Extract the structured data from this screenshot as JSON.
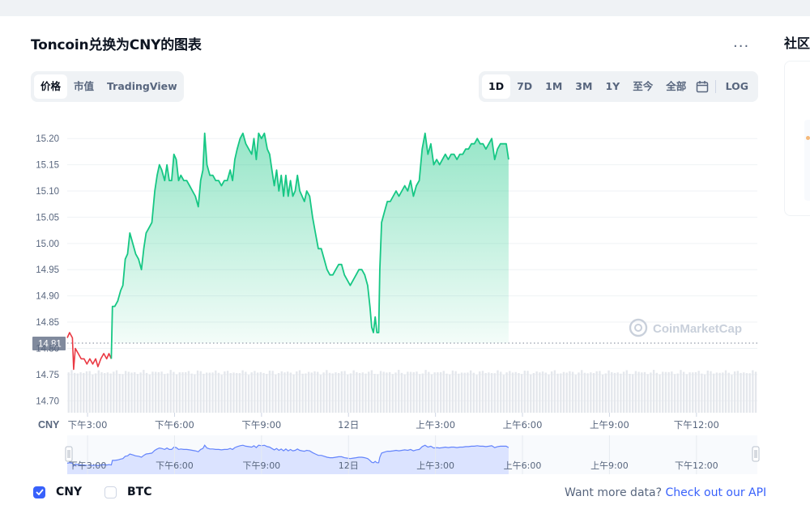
{
  "header": {
    "title": "Toncoin兑换为CNY的图表",
    "more_label": "..."
  },
  "tabs": [
    {
      "label": "价格",
      "active": true
    },
    {
      "label": "市值",
      "active": false
    },
    {
      "label": "TradingView",
      "active": false
    }
  ],
  "ranges": [
    {
      "label": "1D",
      "active": true
    },
    {
      "label": "7D",
      "active": false
    },
    {
      "label": "1M",
      "active": false
    },
    {
      "label": "3M",
      "active": false
    },
    {
      "label": "1Y",
      "active": false
    },
    {
      "label": "至今",
      "active": false
    },
    {
      "label": "全部",
      "active": false
    }
  ],
  "log_label": "LOG",
  "sidebar": {
    "title": "社区"
  },
  "footer": {
    "cny_label": "CNY",
    "btc_label": "BTC",
    "cny_checked": true,
    "btc_checked": false,
    "want_more": "Want more data?",
    "api_link": "Check out our API"
  },
  "colors": {
    "up": "#16c784",
    "down": "#ea3943",
    "accent": "#3861fb",
    "grid": "#eff2f5",
    "navigator_fill": "#dbe3ff",
    "navigator_line": "#3861fb"
  },
  "chart_data": {
    "type": "area",
    "title": "",
    "watermark": "CoinMarketCap",
    "axis_currency_label": "CNY",
    "y_ticks": [
      14.7,
      14.75,
      14.8,
      14.85,
      14.9,
      14.95,
      15.0,
      15.05,
      15.1,
      15.15,
      15.2
    ],
    "y_tick_labels": [
      "14.70",
      "14.75",
      "14.80",
      "14.85",
      "14.90",
      "14.95",
      "15.00",
      "15.05",
      "15.10",
      "15.15",
      "15.20"
    ],
    "ylim": [
      14.685,
      15.225
    ],
    "x_range_hours": [
      14.3,
      38.1
    ],
    "x_ticks": [
      {
        "label": "下午3:00",
        "hour": 15
      },
      {
        "label": "下午6:00",
        "hour": 18
      },
      {
        "label": "下午9:00",
        "hour": 21
      },
      {
        "label": "12日",
        "hour": 24
      },
      {
        "label": "上午3:00",
        "hour": 27
      },
      {
        "label": "上午6:00",
        "hour": 30
      },
      {
        "label": "上午9:00",
        "hour": 33
      },
      {
        "label": "下午12:00",
        "hour": 36
      }
    ],
    "reference_price": 14.81,
    "reference_label": "14.81",
    "grid": true,
    "series": [
      {
        "values": [
          [
            14.3,
            14.82
          ],
          [
            14.38,
            14.83
          ],
          [
            14.48,
            14.82
          ],
          [
            14.52,
            14.76
          ],
          [
            14.58,
            14.8
          ],
          [
            14.68,
            14.79
          ],
          [
            14.78,
            14.78
          ],
          [
            14.88,
            14.78
          ],
          [
            14.98,
            14.77
          ],
          [
            15.08,
            14.78
          ],
          [
            15.18,
            14.77
          ],
          [
            15.28,
            14.78
          ],
          [
            15.36,
            14.765
          ],
          [
            15.46,
            14.78
          ],
          [
            15.56,
            14.79
          ],
          [
            15.66,
            14.78
          ],
          [
            15.74,
            14.79
          ],
          [
            15.82,
            14.78
          ],
          [
            15.86,
            14.88
          ],
          [
            15.94,
            14.88
          ],
          [
            16.04,
            14.89
          ],
          [
            16.14,
            14.91
          ],
          [
            16.22,
            14.92
          ],
          [
            16.3,
            14.97
          ],
          [
            16.38,
            14.98
          ],
          [
            16.46,
            15.02
          ],
          [
            16.56,
            15.0
          ],
          [
            16.66,
            14.98
          ],
          [
            16.76,
            14.97
          ],
          [
            16.86,
            14.95
          ],
          [
            16.94,
            14.99
          ],
          [
            17.02,
            15.02
          ],
          [
            17.12,
            15.03
          ],
          [
            17.22,
            15.04
          ],
          [
            17.32,
            15.1
          ],
          [
            17.4,
            15.13
          ],
          [
            17.48,
            15.15
          ],
          [
            17.56,
            15.14
          ],
          [
            17.66,
            15.12
          ],
          [
            17.74,
            15.15
          ],
          [
            17.82,
            15.12
          ],
          [
            17.9,
            15.12
          ],
          [
            17.98,
            15.17
          ],
          [
            18.06,
            15.16
          ],
          [
            18.14,
            15.12
          ],
          [
            18.22,
            15.13
          ],
          [
            18.32,
            15.12
          ],
          [
            18.42,
            15.12
          ],
          [
            18.52,
            15.11
          ],
          [
            18.62,
            15.1
          ],
          [
            18.72,
            15.09
          ],
          [
            18.82,
            15.07
          ],
          [
            18.9,
            15.12
          ],
          [
            18.98,
            15.14
          ],
          [
            19.04,
            15.21
          ],
          [
            19.12,
            15.15
          ],
          [
            19.22,
            15.13
          ],
          [
            19.32,
            15.13
          ],
          [
            19.42,
            15.12
          ],
          [
            19.52,
            15.12
          ],
          [
            19.62,
            15.11
          ],
          [
            19.72,
            15.12
          ],
          [
            19.82,
            15.12
          ],
          [
            19.92,
            15.14
          ],
          [
            20.0,
            15.12
          ],
          [
            20.08,
            15.16
          ],
          [
            20.16,
            15.18
          ],
          [
            20.26,
            15.2
          ],
          [
            20.36,
            15.21
          ],
          [
            20.46,
            15.19
          ],
          [
            20.56,
            15.18
          ],
          [
            20.66,
            15.17
          ],
          [
            20.74,
            15.2
          ],
          [
            20.82,
            15.16
          ],
          [
            20.9,
            15.21
          ],
          [
            21.0,
            15.2
          ],
          [
            21.1,
            15.21
          ],
          [
            21.2,
            15.18
          ],
          [
            21.28,
            15.17
          ],
          [
            21.36,
            15.14
          ],
          [
            21.44,
            15.11
          ],
          [
            21.52,
            15.14
          ],
          [
            21.6,
            15.1
          ],
          [
            21.68,
            15.13
          ],
          [
            21.76,
            15.09
          ],
          [
            21.84,
            15.13
          ],
          [
            21.92,
            15.09
          ],
          [
            22.0,
            15.12
          ],
          [
            22.08,
            15.09
          ],
          [
            22.16,
            15.1
          ],
          [
            22.24,
            15.13
          ],
          [
            22.32,
            15.1
          ],
          [
            22.4,
            15.09
          ],
          [
            22.48,
            15.08
          ],
          [
            22.56,
            15.1
          ],
          [
            22.66,
            15.09
          ],
          [
            22.76,
            15.05
          ],
          [
            22.86,
            15.02
          ],
          [
            22.96,
            14.99
          ],
          [
            23.06,
            14.99
          ],
          [
            23.16,
            14.97
          ],
          [
            23.26,
            14.95
          ],
          [
            23.36,
            14.94
          ],
          [
            23.46,
            14.94
          ],
          [
            23.56,
            14.95
          ],
          [
            23.66,
            14.96
          ],
          [
            23.76,
            14.96
          ],
          [
            23.86,
            14.94
          ],
          [
            23.96,
            14.93
          ],
          [
            24.06,
            14.92
          ],
          [
            24.16,
            14.93
          ],
          [
            24.26,
            14.94
          ],
          [
            24.36,
            14.95
          ],
          [
            24.46,
            14.95
          ],
          [
            24.56,
            14.94
          ],
          [
            24.66,
            14.92
          ],
          [
            24.74,
            14.88
          ],
          [
            24.8,
            14.84
          ],
          [
            24.86,
            14.83
          ],
          [
            24.92,
            14.86
          ],
          [
            24.98,
            14.83
          ],
          [
            25.04,
            14.83
          ],
          [
            25.08,
            14.95
          ],
          [
            25.14,
            15.04
          ],
          [
            25.24,
            15.06
          ],
          [
            25.34,
            15.08
          ],
          [
            25.44,
            15.08
          ],
          [
            25.54,
            15.09
          ],
          [
            25.64,
            15.1
          ],
          [
            25.74,
            15.09
          ],
          [
            25.84,
            15.1
          ],
          [
            25.94,
            15.11
          ],
          [
            26.04,
            15.1
          ],
          [
            26.14,
            15.12
          ],
          [
            26.24,
            15.09
          ],
          [
            26.34,
            15.11
          ],
          [
            26.44,
            15.12
          ],
          [
            26.54,
            15.18
          ],
          [
            26.64,
            15.21
          ],
          [
            26.74,
            15.17
          ],
          [
            26.84,
            15.19
          ],
          [
            26.94,
            15.15
          ],
          [
            27.04,
            15.16
          ],
          [
            27.14,
            15.15
          ],
          [
            27.24,
            15.16
          ],
          [
            27.34,
            15.17
          ],
          [
            27.44,
            15.16
          ],
          [
            27.54,
            15.17
          ],
          [
            27.64,
            15.17
          ],
          [
            27.74,
            15.16
          ],
          [
            27.84,
            15.17
          ],
          [
            27.94,
            15.17
          ],
          [
            28.04,
            15.18
          ],
          [
            28.14,
            15.18
          ],
          [
            28.24,
            15.19
          ],
          [
            28.34,
            15.19
          ],
          [
            28.44,
            15.2
          ],
          [
            28.54,
            15.19
          ],
          [
            28.64,
            15.19
          ],
          [
            28.74,
            15.18
          ],
          [
            28.84,
            15.19
          ],
          [
            28.94,
            15.2
          ],
          [
            29.04,
            15.16
          ],
          [
            29.14,
            15.18
          ],
          [
            29.24,
            15.19
          ],
          [
            29.34,
            15.19
          ],
          [
            29.44,
            15.19
          ],
          [
            29.52,
            15.16
          ]
        ]
      }
    ],
    "volume": {
      "count": 230,
      "min": 0.88,
      "max": 1.0
    },
    "navigator": {
      "x_ticks": [
        "下午3:00",
        "下午6:00",
        "下午9:00",
        "12日",
        "上午3:00",
        "上午6:00",
        "上午9:00",
        "下午12:00"
      ]
    }
  }
}
